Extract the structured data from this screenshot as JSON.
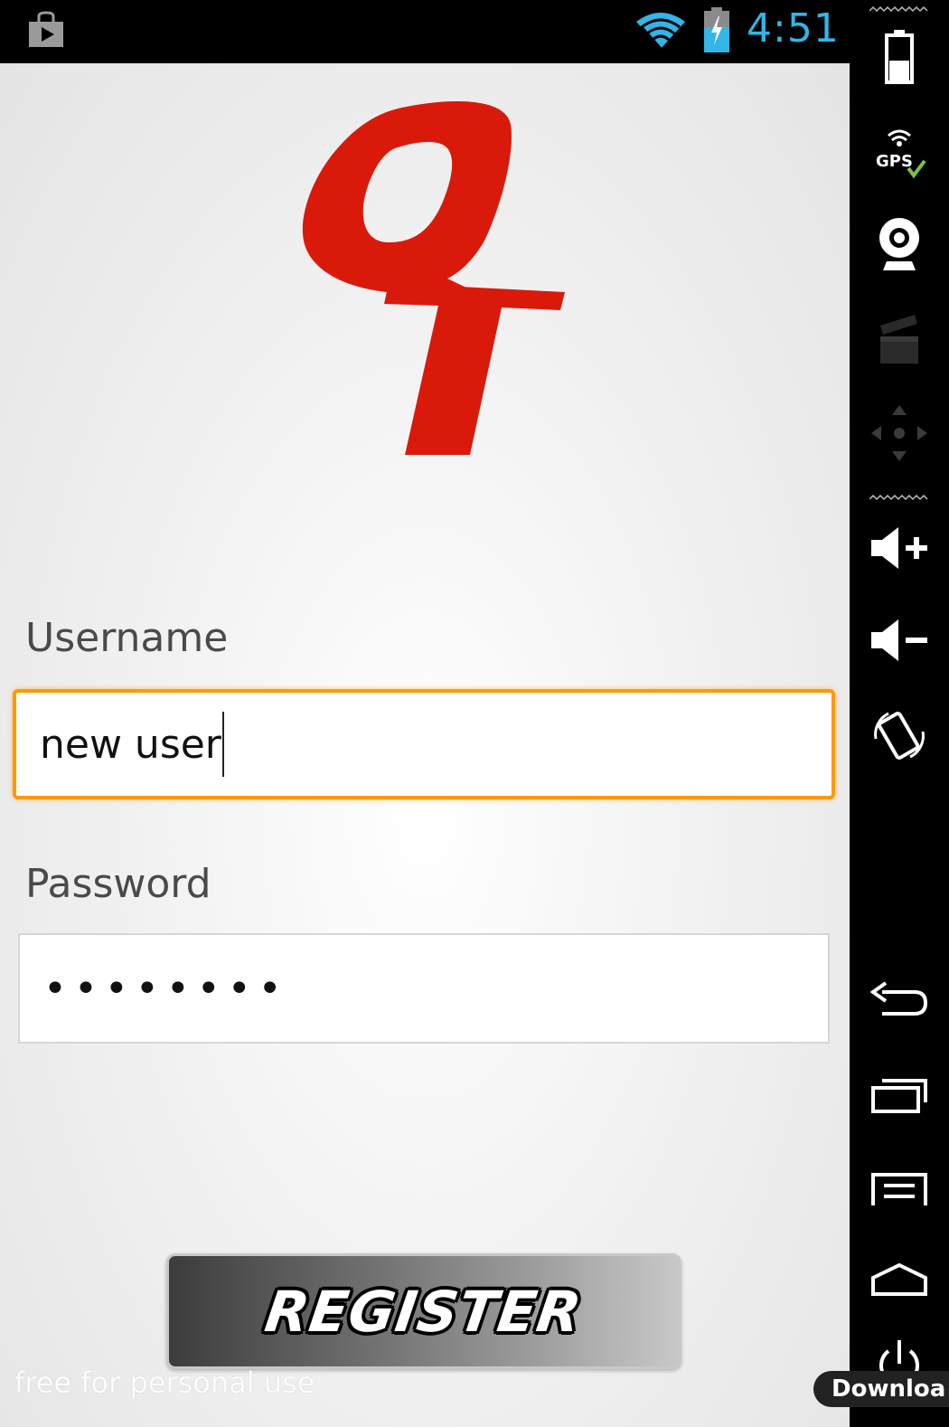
{
  "status_bar": {
    "time": "4:51",
    "left_icon": "play-store-icon",
    "wifi_icon": "wifi-icon",
    "battery_icon": "battery-charging-icon",
    "clock_color": "#33b5e5"
  },
  "app": {
    "logo_icon": "qt-logo",
    "logo_color": "#d91a0a",
    "username": {
      "label": "Username",
      "value": "new user"
    },
    "password": {
      "label": "Password",
      "masked_value": "••••••••"
    },
    "register_button": {
      "label": "REGISTER"
    },
    "watermark": "free for personal use",
    "focus_color": "#ff9a00"
  },
  "emulator_panel": {
    "buttons": [
      {
        "name": "battery",
        "icon": "battery-icon"
      },
      {
        "name": "gps",
        "icon": "gps-icon",
        "label": "GPS"
      },
      {
        "name": "camera",
        "icon": "webcam-icon"
      },
      {
        "name": "media",
        "icon": "clapperboard-icon"
      },
      {
        "name": "dpad",
        "icon": "dpad-icon"
      },
      {
        "name": "volume-up",
        "icon": "volume-up-icon"
      },
      {
        "name": "volume-down",
        "icon": "volume-down-icon"
      },
      {
        "name": "rotate",
        "icon": "rotate-icon"
      },
      {
        "name": "back",
        "icon": "back-icon"
      },
      {
        "name": "recent-apps",
        "icon": "recent-apps-icon"
      },
      {
        "name": "menu",
        "icon": "menu-icon"
      },
      {
        "name": "home",
        "icon": "home-icon"
      },
      {
        "name": "power",
        "icon": "power-icon"
      }
    ],
    "download_label": "Downloa"
  }
}
